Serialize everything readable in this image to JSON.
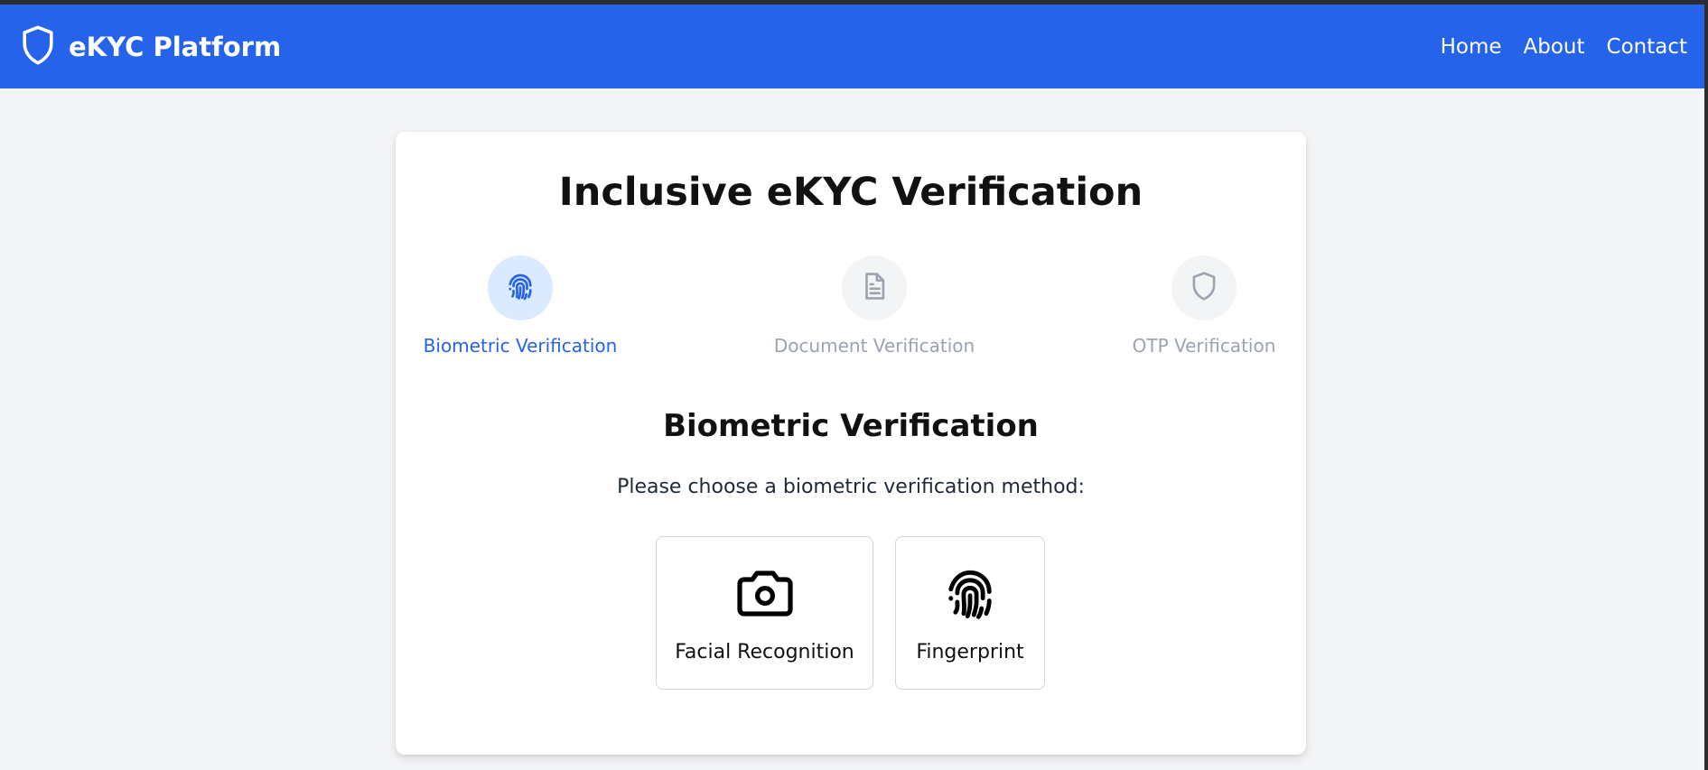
{
  "header": {
    "brand_icon": "shield-icon",
    "brand_title": "eKYC Platform",
    "nav": [
      {
        "label": "Home"
      },
      {
        "label": "About"
      },
      {
        "label": "Contact"
      }
    ]
  },
  "card": {
    "title": "Inclusive eKYC Verification",
    "steps": [
      {
        "label": "Biometric Verification",
        "icon": "fingerprint-icon",
        "status": "active"
      },
      {
        "label": "Document Verification",
        "icon": "document-icon",
        "status": "inactive"
      },
      {
        "label": "OTP Verification",
        "icon": "shield-icon",
        "status": "inactive"
      }
    ],
    "section_title": "Biometric Verification",
    "section_description": "Please choose a biometric verification method:",
    "options": [
      {
        "label": "Facial Recognition",
        "icon": "camera-icon"
      },
      {
        "label": "Fingerprint",
        "icon": "fingerprint-icon"
      }
    ]
  },
  "colors": {
    "primary": "#2563eb",
    "active_step_bg": "#dbeafe",
    "inactive_step_bg": "#f3f4f6",
    "inactive_text": "#9ca3af",
    "page_bg": "#f3f4f6"
  }
}
